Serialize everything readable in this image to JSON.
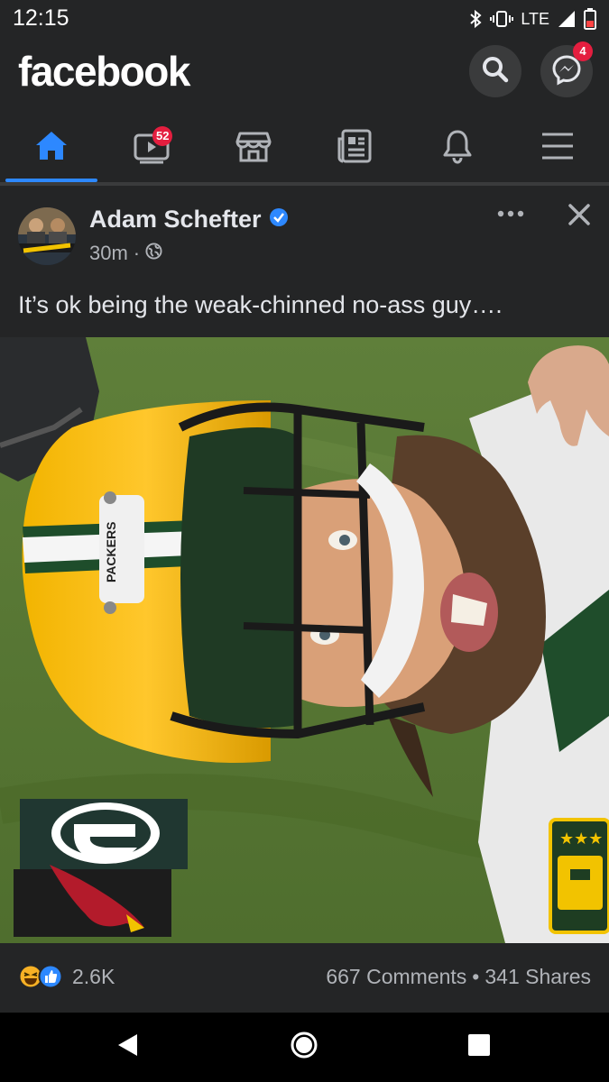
{
  "status_bar": {
    "time": "12:15",
    "network": "LTE"
  },
  "header": {
    "logo": "facebook",
    "messenger_badge": "4"
  },
  "nav": {
    "watch_badge": "52",
    "items": [
      "home-icon",
      "watch-icon",
      "marketplace-icon",
      "news-icon",
      "notifications-icon",
      "menu-icon"
    ],
    "active": "home"
  },
  "post": {
    "author": "Adam Schefter",
    "verified": true,
    "time": "30m",
    "privacy": "globe-icon",
    "text": "It’s ok being the weak-chinned no-ass guy….",
    "image": {
      "helmet_text": "PACKERS",
      "jersey_stars": "★★★"
    },
    "reactions": {
      "types": [
        "haha",
        "like"
      ],
      "count": "2.6K"
    },
    "comments": "667 Comments",
    "separator": "•",
    "shares": "341 Shares"
  },
  "colors": {
    "accent": "#2d88ff",
    "badge": "#e41e3f",
    "background": "#18191a",
    "surface": "#242526"
  }
}
